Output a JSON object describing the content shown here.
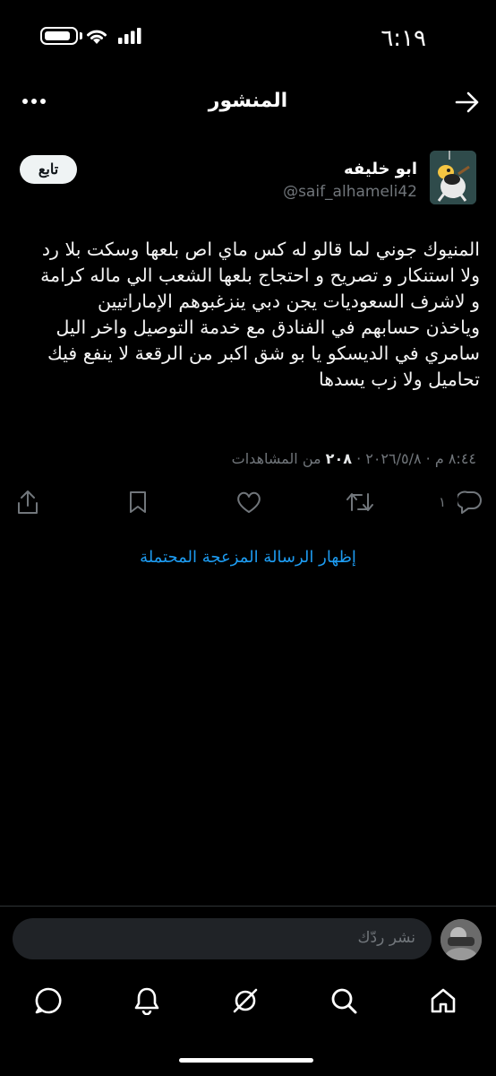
{
  "status_bar": {
    "time": "٦:١٩"
  },
  "header": {
    "title": "المنشور"
  },
  "post": {
    "author_name": "ابو خليفه",
    "handle": "@saif_alhameli42",
    "follow_label": "تابع",
    "body": "المنيوك جوني لما قالو له كس ماي اص بلعها وسكت بلا رد\nولا استنكار و تصريح و احتجاج بلعها الشعب الي ماله كرامة\nو لاشرف السعوديات يجن دبي ينزغبوهم الإماراتيين\nوياخذن حسابهم في الفنادق مع خدمة التوصيل واخر اليل\nسامري في الديسكو يا بو شق اكبر من الرقعة لا ينفع فيك\nتحاميل ولا زب يسدها",
    "timestamp": "٨:٤٤ م · ٢٠٢٦/٥/٨ ·",
    "views_count": "٢٠٨",
    "views_label": "من المشاهدات",
    "reply_count": "١"
  },
  "spam_notice": "إظهار الرسالة المزعجة المحتملة",
  "reply": {
    "placeholder": "نشر ردّك"
  },
  "colors": {
    "background": "#000000",
    "accent": "#1d9bf0",
    "muted": "#71767b"
  }
}
